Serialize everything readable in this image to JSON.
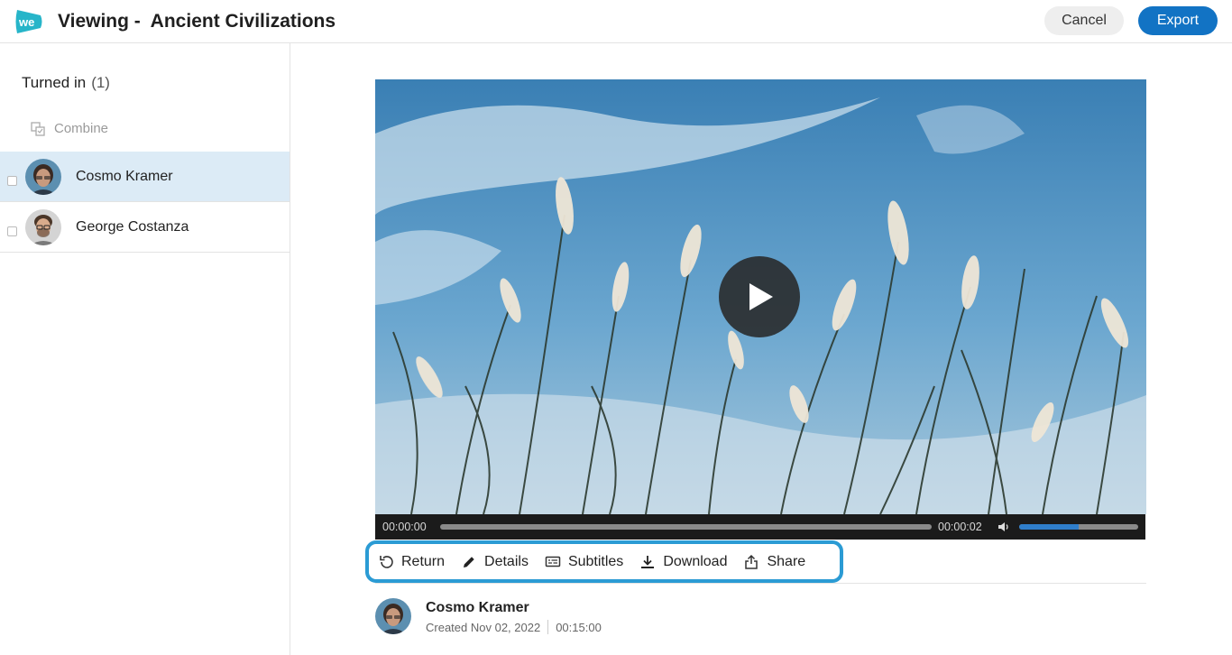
{
  "header": {
    "title": "Viewing -  Ancient Civilizations",
    "cancel_label": "Cancel",
    "export_label": "Export",
    "accent": "#1273c4"
  },
  "sidebar": {
    "section_label": "Turned in",
    "section_count": "(1)",
    "combine_label": "Combine",
    "students": [
      {
        "name": "Cosmo Kramer",
        "selected": true
      },
      {
        "name": "George Costanza",
        "selected": false
      }
    ]
  },
  "player": {
    "current_time": "00:00:00",
    "duration": "00:00:02",
    "progress": 0,
    "volume": 0.5
  },
  "toolbar": {
    "return_label": "Return",
    "details_label": "Details",
    "subtitles_label": "Subtitles",
    "download_label": "Download",
    "share_label": "Share",
    "highlight": "#2b9bd4"
  },
  "info": {
    "name": "Cosmo Kramer",
    "created": "Created Nov 02, 2022",
    "length": "00:15:00"
  }
}
